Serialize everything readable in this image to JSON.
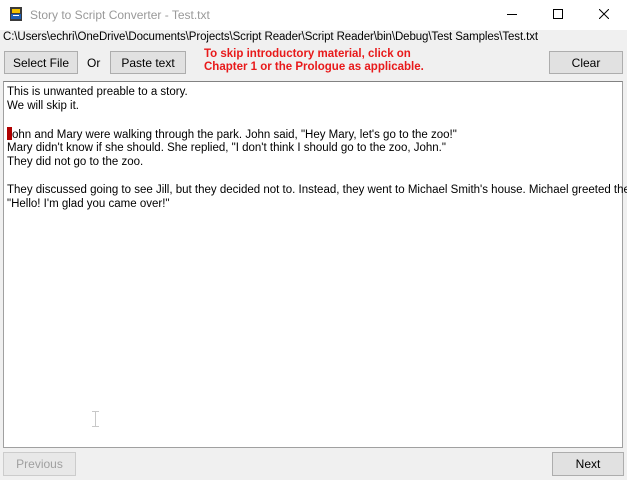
{
  "window": {
    "title": "Story to Script Converter - Test.txt",
    "icon": "script-app-icon"
  },
  "file_path": "C:\\Users\\echri\\OneDrive\\Documents\\Projects\\Script Reader\\Script Reader\\bin\\Debug\\Test Samples\\Test.txt",
  "toolbar": {
    "select_file_label": "Select File",
    "or_label": "Or",
    "paste_text_label": "Paste text",
    "hint_line1": "To skip introductory material, click on",
    "hint_line2": "Chapter 1 or the Prologue as applicable.",
    "clear_label": "Clear",
    "hint_color": "#e8191a"
  },
  "text": {
    "lines": [
      "This is unwanted preable to a story.",
      "We will skip it.",
      "",
      "ohn and Mary were walking through the park. John said, \"Hey Mary, let's go to the zoo!\"",
      "Mary didn't know if she should. She replied, \"I don't think I should go to the zoo, John.\"",
      "They did not go to the zoo.",
      "",
      "They discussed going to see Jill, but they decided not to. Instead, they went to Michael Smith's house. Michael greeted them,",
      "\"Hello! I'm glad you came over!\""
    ]
  },
  "nav": {
    "previous_label": "Previous",
    "next_label": "Next"
  }
}
